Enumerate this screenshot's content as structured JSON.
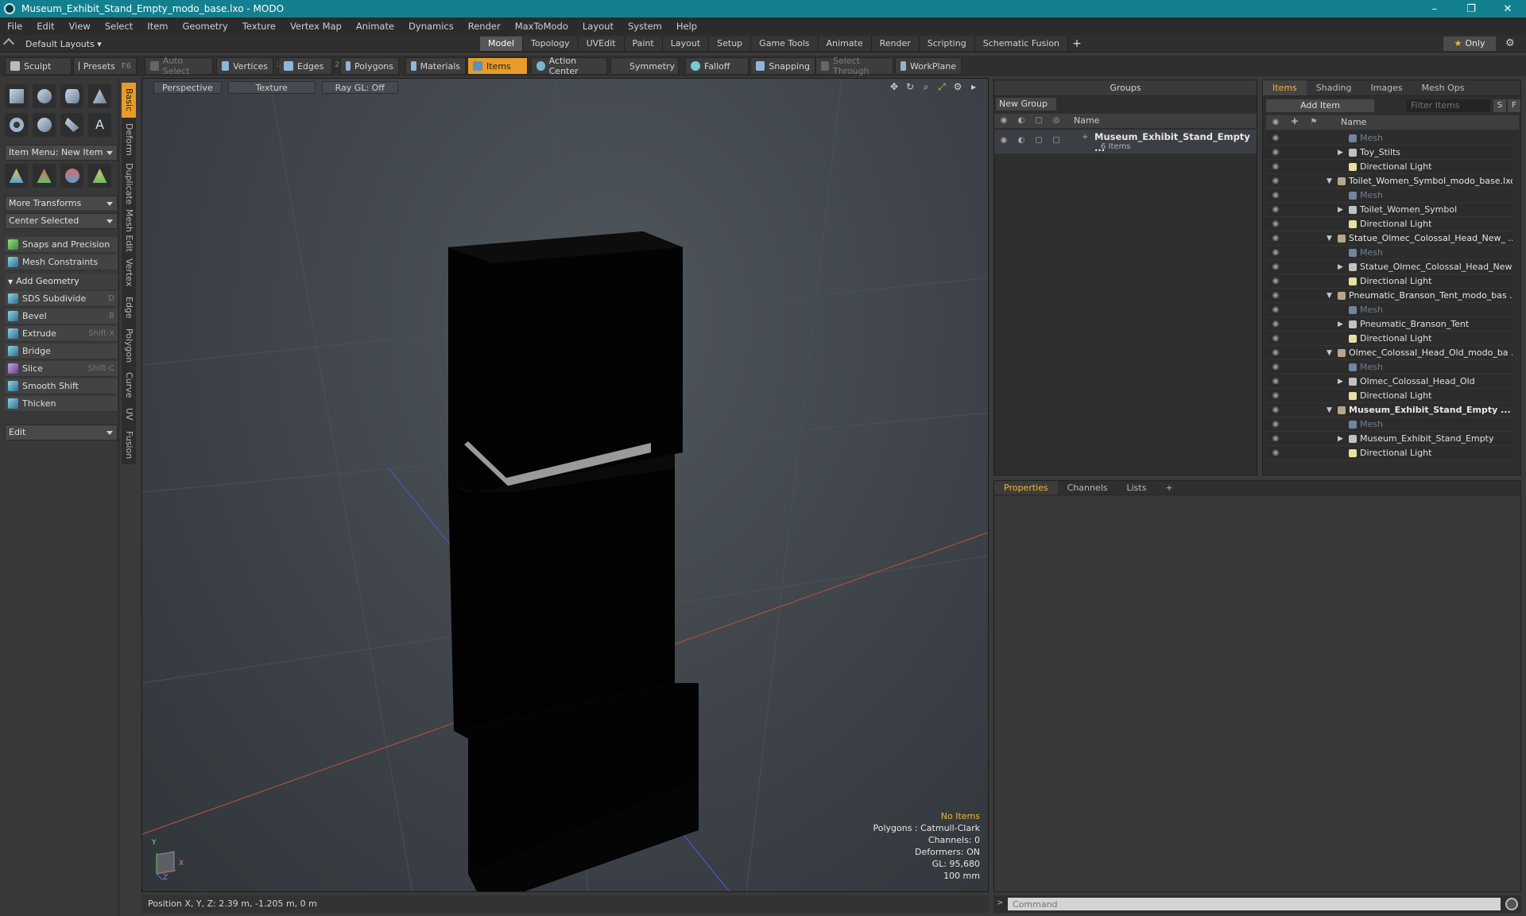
{
  "window": {
    "title": "Museum_Exhibit_Stand_Empty_modo_base.lxo - MODO",
    "controls": [
      "–",
      "❐",
      "✕"
    ]
  },
  "menu": [
    "File",
    "Edit",
    "View",
    "Select",
    "Item",
    "Geometry",
    "Texture",
    "Vertex Map",
    "Animate",
    "Dynamics",
    "Render",
    "MaxToModo",
    "Layout",
    "System",
    "Help"
  ],
  "layoutbar": {
    "layout": "Default Layouts ▾",
    "tabs": [
      "Model",
      "Topology",
      "UVEdit",
      "Paint",
      "Layout",
      "Setup",
      "Game Tools",
      "Animate",
      "Render",
      "Scripting",
      "Schematic Fusion"
    ],
    "active_tab": "Model",
    "add": "+",
    "only": "Only"
  },
  "toolbar": {
    "sculpt": "Sculpt",
    "presets": "Presets",
    "presets_key": "F6",
    "auto_select": "Auto Select",
    "vertices": "Vertices",
    "vertices_n": "1",
    "edges": "Edges",
    "edges_n": "2",
    "polygons": "Polygons",
    "materials": "Materials",
    "items": "Items",
    "action_center": "Action Center",
    "symmetry": "Symmetry",
    "falloff": "Falloff",
    "snapping": "Snapping",
    "select_through": "Select Through",
    "workplane": "WorkPlane"
  },
  "left_panel": {
    "item_menu": "Item Menu: New Item",
    "more_transforms": "More Transforms",
    "center_selected": "Center Selected",
    "snaps": "Snaps and Precision",
    "mesh_constraints": "Mesh Constraints",
    "add_geometry": "Add Geometry",
    "tools": [
      {
        "label": "SDS Subdivide",
        "key": "D"
      },
      {
        "label": "Bevel",
        "key": "B"
      },
      {
        "label": "Extrude",
        "key": "Shift-X"
      },
      {
        "label": "Bridge",
        "key": ""
      },
      {
        "label": "Slice",
        "key": "Shift-C"
      },
      {
        "label": "Smooth Shift",
        "key": ""
      },
      {
        "label": "Thicken",
        "key": ""
      }
    ],
    "edit": "Edit",
    "side_tabs": [
      "Basic",
      "Deform",
      "Duplicate",
      "Mesh Edit",
      "Vertex",
      "Edge",
      "Polygon",
      "Curve",
      "UV",
      "Fusion"
    ]
  },
  "viewport": {
    "perspective": "Perspective",
    "texture": "Texture",
    "raygl": "Ray GL: Off",
    "info": {
      "no_items": "No Items",
      "polygons": "Polygons : Catmull-Clark",
      "channels": "Channels: 0",
      "deformers": "Deformers: ON",
      "gl": "GL: 95,680",
      "scale": "100 mm"
    },
    "axis_y": "Y",
    "axis_x": "X",
    "axis_z": "Z"
  },
  "status": "Position X, Y, Z:   2.39 m, -1.205 m, 0 m",
  "groups": {
    "title": "Groups",
    "new_group": "New Group",
    "col_name": "Name",
    "group_name": "Museum_Exhibit_Stand_Empty ...",
    "group_count": "6 Items"
  },
  "items": {
    "tabs": [
      "Items",
      "Shading",
      "Images",
      "Mesh Ops"
    ],
    "add_item": "Add Item",
    "filter": "Filter Items",
    "s": "S",
    "f": "F",
    "col_name": "Name",
    "rows": [
      {
        "label": "Mesh",
        "kind": "mesh",
        "indent": 2
      },
      {
        "label": "Toy_Stilts",
        "kind": "group",
        "indent": 2
      },
      {
        "label": "Directional Light",
        "kind": "light",
        "indent": 2
      },
      {
        "label": "Toilet_Women_Symbol_modo_base.lxo",
        "kind": "scene",
        "indent": 1
      },
      {
        "label": "Mesh",
        "kind": "mesh",
        "indent": 2
      },
      {
        "label": "Toilet_Women_Symbol",
        "kind": "group",
        "indent": 2
      },
      {
        "label": "Directional Light",
        "kind": "light",
        "indent": 2
      },
      {
        "label": "Statue_Olmec_Colossal_Head_New_ ...",
        "kind": "scene",
        "indent": 1
      },
      {
        "label": "Mesh",
        "kind": "mesh",
        "indent": 2
      },
      {
        "label": "Statue_Olmec_Colossal_Head_New",
        "kind": "group",
        "indent": 2
      },
      {
        "label": "Directional Light",
        "kind": "light",
        "indent": 2
      },
      {
        "label": "Pneumatic_Branson_Tent_modo_bas ...",
        "kind": "scene",
        "indent": 1
      },
      {
        "label": "Mesh",
        "kind": "mesh",
        "indent": 2
      },
      {
        "label": "Pneumatic_Branson_Tent",
        "kind": "group",
        "indent": 2
      },
      {
        "label": "Directional Light",
        "kind": "light",
        "indent": 2
      },
      {
        "label": "Olmec_Colossal_Head_Old_modo_ba ...",
        "kind": "scene",
        "indent": 1
      },
      {
        "label": "Mesh",
        "kind": "mesh",
        "indent": 2
      },
      {
        "label": "Olmec_Colossal_Head_Old",
        "kind": "group",
        "indent": 2
      },
      {
        "label": "Directional Light",
        "kind": "light",
        "indent": 2
      },
      {
        "label": "Museum_Exhibit_Stand_Empty ...",
        "kind": "scene",
        "indent": 1,
        "bold": true
      },
      {
        "label": "Mesh",
        "kind": "mesh",
        "indent": 2
      },
      {
        "label": "Museum_Exhibit_Stand_Empty",
        "kind": "group",
        "indent": 2
      },
      {
        "label": "Directional Light",
        "kind": "light",
        "indent": 2
      }
    ]
  },
  "properties": {
    "tabs": [
      "Properties",
      "Channels",
      "Lists"
    ],
    "add": "+"
  },
  "command": {
    "placeholder": "Command"
  },
  "colors": {
    "accent": "#e89b2a",
    "titlebar": "#12808f",
    "highlight": "#f2b632"
  }
}
